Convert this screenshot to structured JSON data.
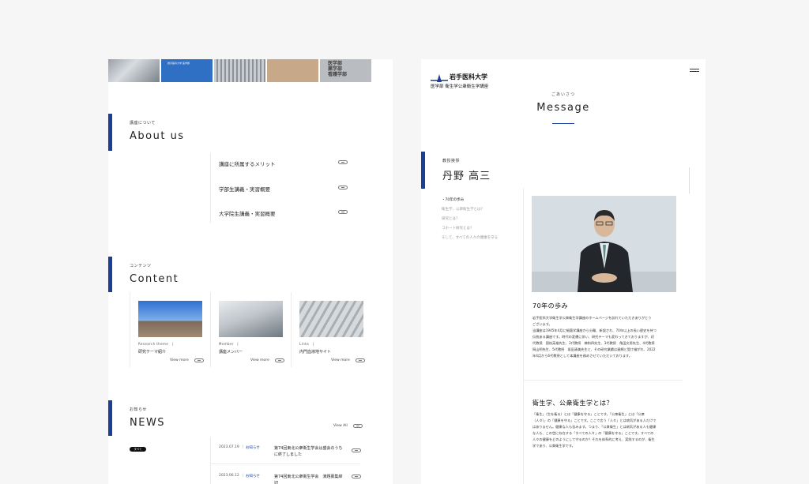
{
  "hero": {
    "sign_text": "岩手医科大学 医学部",
    "sign2": [
      "医学部",
      "薬学部",
      "看護学部"
    ]
  },
  "about": {
    "sub": "講座について",
    "title": "About us",
    "links": [
      "講座に所属するメリット",
      "学部生講義・実習概要",
      "大学院生講義・実習概要"
    ]
  },
  "content": {
    "sub": "コンテンツ",
    "title": "Content",
    "cards": [
      {
        "cat": "Research theme　|",
        "title": "研究テーマ紹介",
        "more": "View more"
      },
      {
        "cat": "Member　|",
        "title": "講座メンバー",
        "more": "View more"
      },
      {
        "cat": "Links　|",
        "title": "内門血液地サイト",
        "more": "View more"
      }
    ]
  },
  "news": {
    "sub": "お知らせ",
    "title": "NEWS",
    "view_all": "View All",
    "all_badge": "すべて",
    "items": [
      {
        "date": "2023.07.19",
        "sep": "|",
        "tag": "お知らせ",
        "text": "第74回東北公衆衛生学会は盛会のうちに終了しました"
      },
      {
        "date": "2023.06.12",
        "sep": "|",
        "tag": "お知らせ",
        "text": "第74回東北公衆衛生学会　演題募集締切"
      }
    ]
  },
  "right": {
    "logo_name": "岩手医科大学",
    "logo_sub": "医学部 衛生学公衆衛生学講座",
    "msg_sub": "ごあいさつ",
    "msg_title": "Message",
    "role": "教授挨拶",
    "name": "丹野 高三",
    "toc": [
      "・70年の歩み",
      "衛生学、公衆衛生学とは？",
      "研究とは？",
      "コホート研究とは？",
      "そして、すべての人々の健康を守る"
    ],
    "section1_title": "70年の歩み",
    "section1_lines": [
      "岩手医科大学衛生学公衆衛生学講座のホームページを訪れていただきありがとう",
      "ございます。",
      "当講座は1945年4月に細菌学講座から分離、新設され、70年以上の長い歴史を持つ",
      "伝統ある講座です。時代の変遷に伴い、研究テーマも変わってきておりますが、初",
      "代教授　国枝英雄先生、2代教授　榊和四先生、3代教授　角田文男先生、4代教授",
      "岡山明先生、5代教授　坂田清美先生と、その研究業績は連綿と受け継がれ、2022",
      "年4月から6代教授として本講座を務めさせていただいております。"
    ],
    "section2_title": "衛生学、公衆衛生学とは？",
    "section2_lines": [
      "「衛生」（生を衛る）とは「健康を守る」ことです。「公衆衛生」とは「公衆",
      "（人々）」の「健康を守る」ことです。ここで言う「人々」とは病気がある人だけで",
      "はありません。健康な人も含みます。つまり、「公衆衛生」とは病気がある人も健康",
      "な人も、この世に存在する「すべての人々」の「健康を守る」ことです。すべての",
      "人々の健康をどのようにして守るのか？それを体系的に考え、実践するのが、衛生",
      "学であり、公衆衛生学です。"
    ]
  },
  "colors": {
    "accent": "#1b3f96",
    "background": "#f6f6f6",
    "panel": "#ffffff"
  }
}
